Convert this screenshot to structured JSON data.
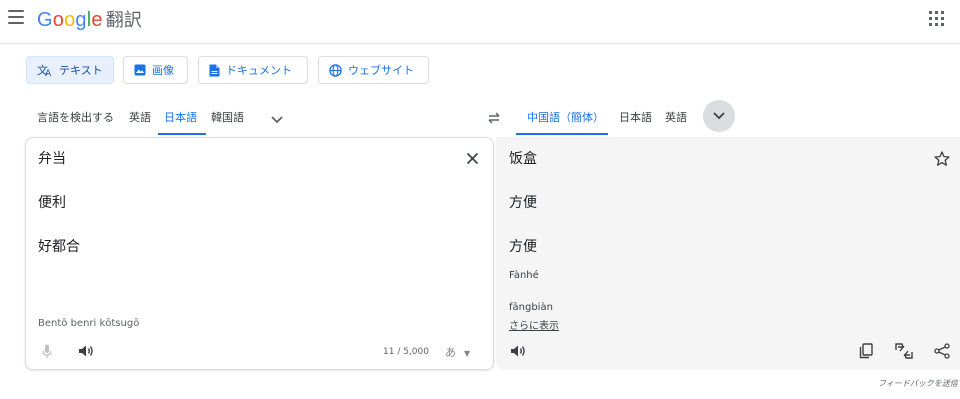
{
  "header": {
    "logo_letters": [
      "G",
      "o",
      "o",
      "g",
      "l",
      "e"
    ],
    "logo_colors": [
      "#4285f4",
      "#ea4335",
      "#fbbc05",
      "#4285f4",
      "#34a853",
      "#ea4335"
    ],
    "product": "翻訳"
  },
  "modes": [
    {
      "label": "テキスト",
      "icon": "translate-icon",
      "active": true
    },
    {
      "label": "画像",
      "icon": "image-icon",
      "active": false
    },
    {
      "label": "ドキュメント",
      "icon": "document-icon",
      "active": false
    },
    {
      "label": "ウェブサイト",
      "icon": "globe-icon",
      "active": false
    }
  ],
  "source_languages": [
    "言語を検出する",
    "英語",
    "日本語",
    "韓国語"
  ],
  "source_active": "日本語",
  "target_languages": [
    "中国語（簡体）",
    "日本語",
    "英語"
  ],
  "target_active": "中国語（簡体）",
  "source": {
    "lines": [
      "弁当",
      "便利",
      "好都合"
    ],
    "transliteration": "Bentō benri kōtsugō",
    "char_count": "11 / 5,000",
    "ime_label": "あ"
  },
  "target": {
    "lines": [
      "饭盒",
      "方便",
      "方便"
    ],
    "pinyin": [
      "Fànhé",
      "fāngbiàn"
    ],
    "show_more": "さらに表示"
  },
  "footer": {
    "feedback": "フィードバックを送信"
  },
  "colors": {
    "accent": "#1a73e8",
    "active_chip_bg": "#e8f0fe",
    "target_panel_bg": "#f5f5f5"
  }
}
